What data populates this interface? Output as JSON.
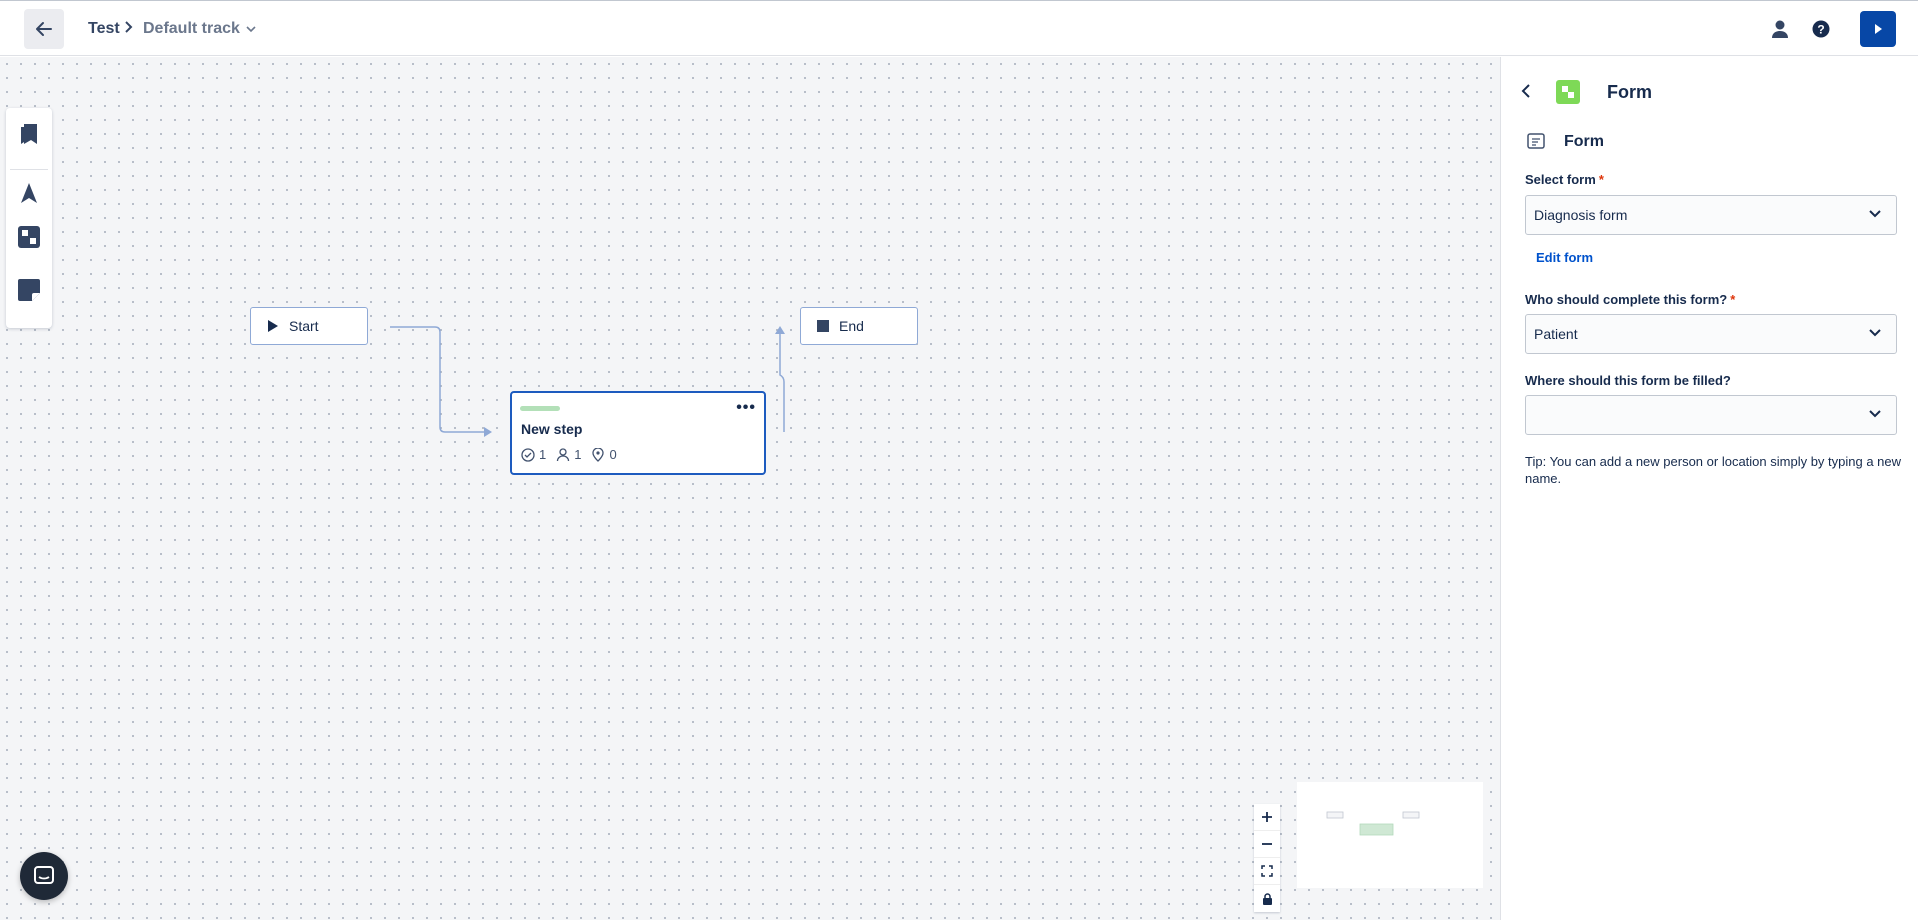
{
  "header": {
    "project": "Test",
    "track": "Default track",
    "icons": [
      "arrow-left-icon",
      "chevron-right-icon",
      "chevron-down-icon",
      "user-icon",
      "help-icon",
      "play-icon"
    ]
  },
  "toolbar": {
    "tools": [
      "bookmark-icon",
      "navigation-icon",
      "form-icon",
      "note-icon"
    ]
  },
  "canvas": {
    "nodes": {
      "start": "Start",
      "end": "End"
    },
    "step": {
      "title": "New step",
      "forms": "1",
      "people": "1",
      "locations": "0",
      "accent": "#b3e0b8"
    },
    "zoom": [
      "+",
      "−",
      "fit",
      "lock"
    ]
  },
  "panel": {
    "header_title": "Form",
    "section_title": "Form",
    "select_form_label": "Select form",
    "select_form_value": "Diagnosis form",
    "edit_form_link": "Edit form",
    "who_label": "Who should complete this form?",
    "who_value": "Patient",
    "where_label": "Where should this form be filled?",
    "where_value": "",
    "required_mark": "*",
    "tip": "Tip: You can add a new person or location simply by typing a new name."
  },
  "colors": {
    "primary": "#0747a6",
    "link": "#0052cc",
    "required": "#de350b",
    "badge": "#7ed957",
    "selected_border": "#1d5bbf"
  }
}
